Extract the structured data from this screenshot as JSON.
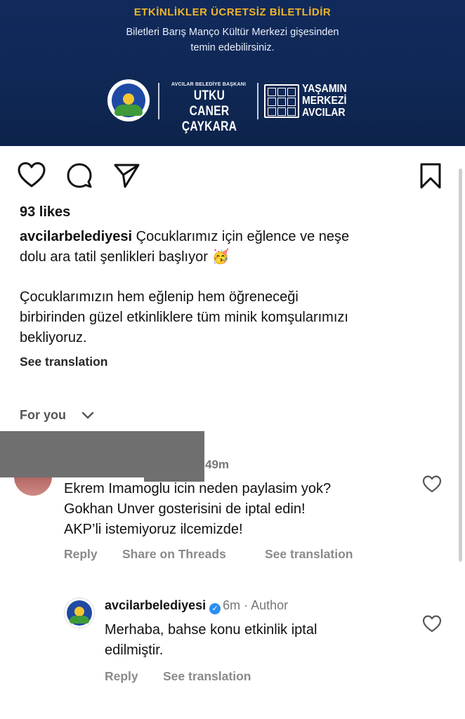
{
  "banner": {
    "title": "ETKİNLİKLER ÜCRETSİZ BİLETLİDİR",
    "subtitle_line1": "Biletleri Barış Manço Kültür Merkezi gişesinden",
    "subtitle_line2": "temin edebilirsiniz.",
    "mayor_title": "AVCILAR BELEDİYE BAŞKANI",
    "mayor_name_line1": "UTKU CANER",
    "mayor_name_line2": "ÇAYKARA",
    "slogan_line1": "YAŞAMIN",
    "slogan_line2": "MERKEZİ",
    "slogan_line3": "AVCILAR"
  },
  "actions": {
    "like_icon": "heart-icon",
    "comment_icon": "comment-icon",
    "share_icon": "send-icon",
    "save_icon": "bookmark-icon"
  },
  "post": {
    "likes": "93 likes",
    "username": "avcilarbelediyesi",
    "caption_line1_rest": " Çocuklarımız için eğlence ve neşe",
    "caption_line2": "dolu ara tatil şenlikleri başlıyor",
    "caption_emoji": "🥳",
    "caption_para2_line1": "Çocuklarımızın hem eğlenip hem öğreneceği",
    "caption_para2_line2": "birbirinden güzel etkinliklere tüm minik komşularımızı",
    "caption_para2_line3": "bekliyoruz.",
    "see_translation": "See translation"
  },
  "comments_filter": {
    "label": "For you"
  },
  "comment1": {
    "time": "49m",
    "line1": "Ekrem Imamoglu icin neden paylasim yok?",
    "line2": "Gokhan Unver gosterisini de iptal edin!",
    "line3": "AKP’li istemiyoruz ilcemizde!",
    "reply": "Reply",
    "share": "Share on Threads",
    "translate": "See translation"
  },
  "comment2": {
    "username": "avcilarbelediyesi",
    "time": "6m",
    "separator": " · ",
    "badge": "Author",
    "line1": "Merhaba, bahse konu etkinlik iptal",
    "line2": "edilmiştir.",
    "reply": "Reply",
    "translate": "See translation"
  }
}
